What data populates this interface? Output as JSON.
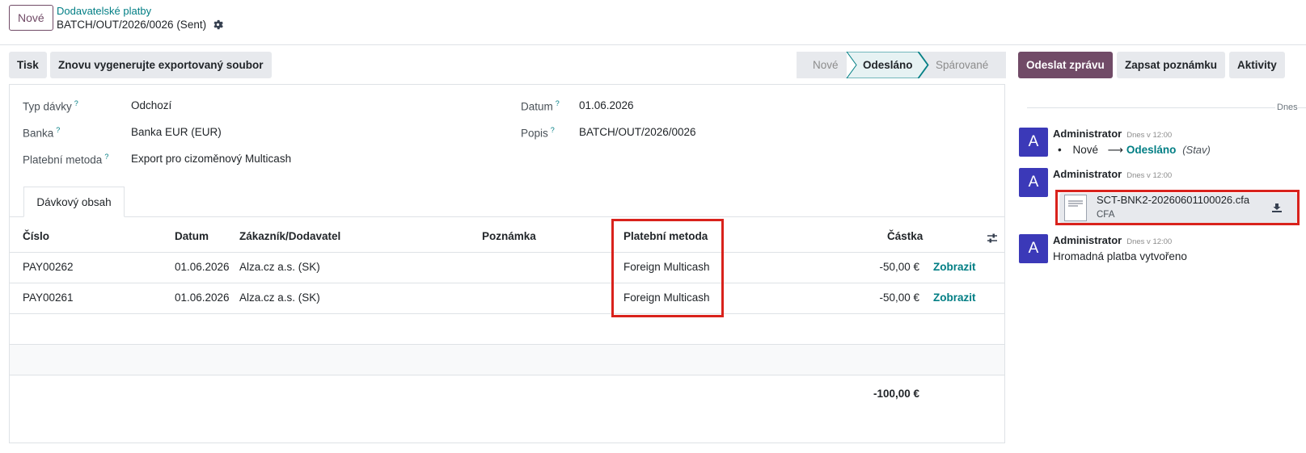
{
  "header": {
    "new_button": "Nové",
    "breadcrumb_parent": "Dodavatelské platby",
    "breadcrumb_current": "BATCH/OUT/2026/0026 (Sent)"
  },
  "actions": {
    "print": "Tisk",
    "regenerate": "Znovu vygenerujte exportovaný soubor"
  },
  "status": {
    "stages": [
      "Nové",
      "Odesláno",
      "Spárované"
    ],
    "active": "Odesláno"
  },
  "form": {
    "fields": {
      "batch_type": {
        "label": "Typ dávky",
        "value": "Odchozí"
      },
      "bank": {
        "label": "Banka",
        "value": "Banka EUR (EUR)"
      },
      "payment_method": {
        "label": "Platební metoda",
        "value": "Export pro cizoměnový Multicash"
      },
      "date": {
        "label": "Datum",
        "value": "01.06.2026"
      },
      "description": {
        "label": "Popis",
        "value": "BATCH/OUT/2026/0026"
      }
    },
    "help_mark": "?",
    "tab": "Dávkový obsah"
  },
  "table": {
    "headers": {
      "number": "Číslo",
      "date": "Datum",
      "partner": "Zákazník/Dodavatel",
      "note": "Poznámka",
      "method": "Platební metoda",
      "amount": "Částka"
    },
    "rows": [
      {
        "number": "PAY00262",
        "date": "01.06.2026",
        "partner": "Alza.cz a.s. (SK)",
        "method": "Foreign Multicash",
        "amount": "-50,00 €",
        "action": "Zobrazit"
      },
      {
        "number": "PAY00261",
        "date": "01.06.2026",
        "partner": "Alza.cz a.s. (SK)",
        "method": "Foreign Multicash",
        "amount": "-50,00 €",
        "action": "Zobrazit"
      }
    ],
    "total": "-100,00 €"
  },
  "chatter": {
    "send_message": "Odeslat zprávu",
    "log_note": "Zapsat poznámku",
    "activities": "Aktivity",
    "day": "Dnes",
    "messages": [
      {
        "avatar": "A",
        "author": "Administrator",
        "date": "Dnes v 12:00",
        "from": "Nové",
        "to": "Odesláno",
        "field": "(Stav)"
      },
      {
        "avatar": "A",
        "author": "Administrator",
        "date": "Dnes v 12:00",
        "attachment_name": "SCT-BNK2-20260601100026.cfa",
        "attachment_ext": "CFA"
      },
      {
        "avatar": "A",
        "author": "Administrator",
        "date": "Dnes v 12:00",
        "body": "Hromadná platba vytvořeno"
      }
    ]
  },
  "colors": {
    "brand": "#714b67",
    "link": "#017e84",
    "avatar": "#3b39b8",
    "highlight": "#d9221c"
  }
}
